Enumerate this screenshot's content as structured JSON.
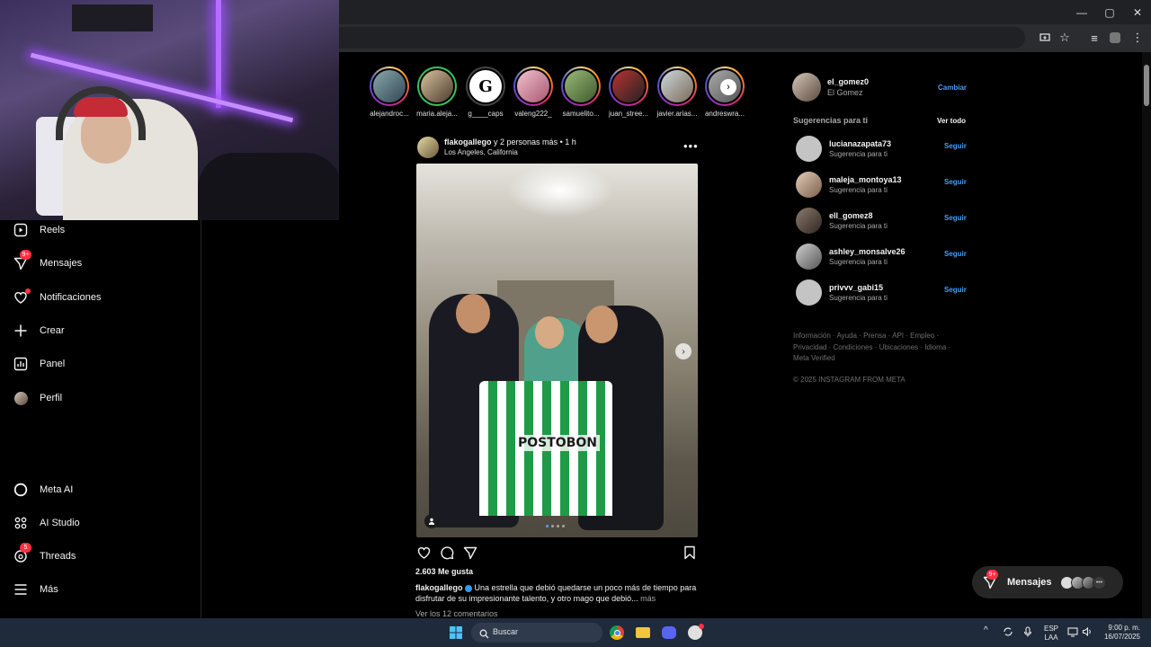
{
  "window": {
    "controls": [
      "—",
      "▢",
      "✕"
    ]
  },
  "sidebar": {
    "items": [
      {
        "label": "Reels",
        "icon": "reels-icon"
      },
      {
        "label": "Mensajes",
        "icon": "messages-icon",
        "badge": "9+"
      },
      {
        "label": "Notificaciones",
        "icon": "heart-icon",
        "dot": true
      },
      {
        "label": "Crear",
        "icon": "plus-icon"
      },
      {
        "label": "Panel",
        "icon": "dashboard-icon"
      },
      {
        "label": "Perfil",
        "icon": "avatar-icon"
      },
      {
        "label": "Meta AI",
        "icon": "meta-ai-icon"
      },
      {
        "label": "AI Studio",
        "icon": "ai-studio-icon"
      },
      {
        "label": "Threads",
        "icon": "threads-icon",
        "badge": "5"
      },
      {
        "label": "Más",
        "icon": "menu-icon"
      }
    ]
  },
  "stories": [
    {
      "name": "alejandroc...",
      "ring": "gradient"
    },
    {
      "name": "maria.aleja...",
      "ring": "green"
    },
    {
      "name": "g____caps",
      "ring": "seen"
    },
    {
      "name": "valeng222_",
      "ring": "gradient"
    },
    {
      "name": "samuelito...",
      "ring": "gradient"
    },
    {
      "name": "juan_stree...",
      "ring": "gradient"
    },
    {
      "name": "javier.arias...",
      "ring": "gradient"
    },
    {
      "name": "andreswra...",
      "ring": "gradient"
    }
  ],
  "post": {
    "user": "flakogallego",
    "coauthors": "y 2 personas más",
    "time": "1 h",
    "location": "Los Angeles, California",
    "sponsor_text": "POSTOBON",
    "likes": "2.603 Me gusta",
    "caption_user": "flakogallego",
    "caption": "Una estrella que debió quedarse un poco más de tiempo para disfrutar de su impresionante talento, y otro mago que debió...",
    "caption_more": "más",
    "comments": "Ver los 12 comentarios"
  },
  "account": {
    "username": "el_gomez0",
    "name": "El Gomez",
    "switch_label": "Cambiar"
  },
  "suggestions": {
    "title": "Sugerencias para ti",
    "see_all": "Ver todo",
    "items": [
      {
        "user": "lucianazapata73",
        "sub": "Sugerencia para ti",
        "action": "Seguir",
        "avatar": "#c4c4c4"
      },
      {
        "user": "maleja_montoya13",
        "sub": "Sugerencia para ti",
        "action": "Seguir",
        "avatar": "#b9a08d"
      },
      {
        "user": "ell_gomez8",
        "sub": "Sugerencia para ti",
        "action": "Seguir",
        "avatar": "#6e5e52"
      },
      {
        "user": "ashley_monsalve26",
        "sub": "Sugerencia para ti",
        "action": "Seguir",
        "avatar": "#9a9a9a"
      },
      {
        "user": "privvv_gabi15",
        "sub": "Sugerencia para ti",
        "action": "Seguir",
        "avatar": "#c4c4c4"
      }
    ]
  },
  "footer": {
    "links": "Información · Ayuda · Prensa · API · Empleo · Privacidad · Condiciones · Ubicaciones · Idioma · Meta Verified",
    "copyright": "© 2025 INSTAGRAM FROM META"
  },
  "messages_pill": {
    "label": "Mensajes",
    "badge": "9+"
  },
  "taskbar": {
    "search_label": "Buscar",
    "lang": "ESP",
    "lang2": "LAA",
    "time": "9:00 p. m.",
    "date": "16/07/2025"
  },
  "colors": {
    "link": "#4a9df8",
    "badge": "#ff3040",
    "bg": "#000000"
  }
}
